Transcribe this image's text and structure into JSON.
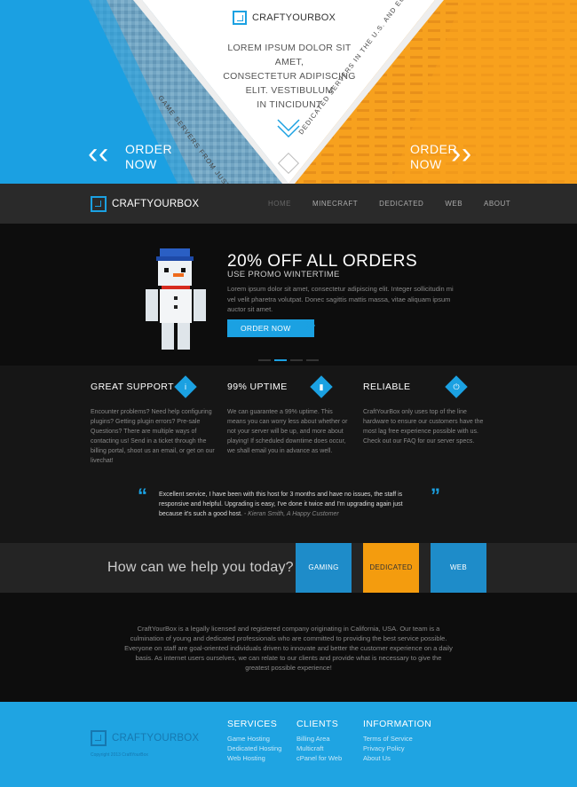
{
  "hero": {
    "brand": "CRAFTYOURBOX",
    "tagline": [
      "LOREM IPSUM DOLOR SIT AMET,",
      "CONSECTETUR ADIPISCING",
      "ELIT. VESTIBULUM",
      "IN TINCIDUNT"
    ],
    "left_diagonal": "GAME SERVERS FROM JUST $1.99",
    "right_diagonal": "DEDICATED SERVERS IN THE U.S. AND EUROPE",
    "order_left": [
      "ORDER",
      "NOW"
    ],
    "order_right": [
      "ORDER",
      "NOW"
    ],
    "colors": {
      "left": "#1ba1e2",
      "right": "#f9a11b"
    }
  },
  "nav": {
    "brand": "CRAFTYOURBOX",
    "items": [
      "HOME",
      "MINECRAFT",
      "DEDICATED",
      "WEB",
      "ABOUT"
    ],
    "active": "HOME"
  },
  "promo": {
    "title": "20% OFF ALL ORDERS",
    "subtitle": "USE PROMO WINTERTIME",
    "body": "Lorem ipsum dolor sit amet, consectetur adipiscing elit. Integer sollicitudin mi vel velit pharetra volutpat. Donec sagittis mattis massa, vitae aliquam ipsum auctor sit amet.",
    "button": "ORDER NOW",
    "slide_active": 2,
    "slide_count": 4
  },
  "features": [
    {
      "title": "GREAT SUPPORT",
      "icon": "info-icon",
      "text": "Encounter problems? Need help configuring plugins? Getting plugin errors? Pre-sale Questions? There are multiple ways of contacting us!  Send in a ticket through the billing portal, shoot us an email, or get on our livechat!"
    },
    {
      "title": "99% UPTIME",
      "icon": "chart-icon",
      "text": "We can guarantee a 99% uptime. This means you can worry less about whether or not your server will be up, and more about playing! If scheduled downtime does occur, we shall email you in advance as well."
    },
    {
      "title": "RELIABLE",
      "icon": "power-icon",
      "text": "CraftYourBox only uses top of the line hardware to ensure our customers have the most lag free experience possible with us.  Check out our FAQ for our server specs."
    }
  ],
  "quote": {
    "text": "Excellent service, I have been with this host for 3 months and have no issues, the staff is responsive and helpful. Upgrading is easy, I've done it twice and I'm upgrading again just because it's such a good host.",
    "author": " - Kieran Smith, A Happy Customer"
  },
  "help": {
    "title": "How can we help you today?",
    "tiles": [
      "GAMING",
      "DEDICATED",
      "WEB"
    ]
  },
  "about": {
    "text": "CraftYourBox is a legally licensed and registered company originating in California, USA. Our team is a culmination of young and dedicated professionals who are committed to providing the best service possible. Everyone on staff are goal-oriented individuals driven to innovate and better the customer experience on a daily basis. As internet users ourselves, we can relate to our clients and provide what is necessary to give the greatest possible experience!"
  },
  "footer": {
    "brand": "CRAFTYOURBOX",
    "copyright": "Copyright 2013 CraftYourBox",
    "columns": [
      {
        "title": "SERVICES",
        "links": [
          "Game Hosting",
          "Dedicated Hosting",
          "Web Hosting"
        ]
      },
      {
        "title": "CLIENTS",
        "links": [
          "Billing Area",
          "Multicraft",
          "cPanel for Web"
        ]
      },
      {
        "title": "INFORMATION",
        "links": [
          "Terms of Service",
          "Privacy Policy",
          "About Us"
        ]
      }
    ]
  }
}
